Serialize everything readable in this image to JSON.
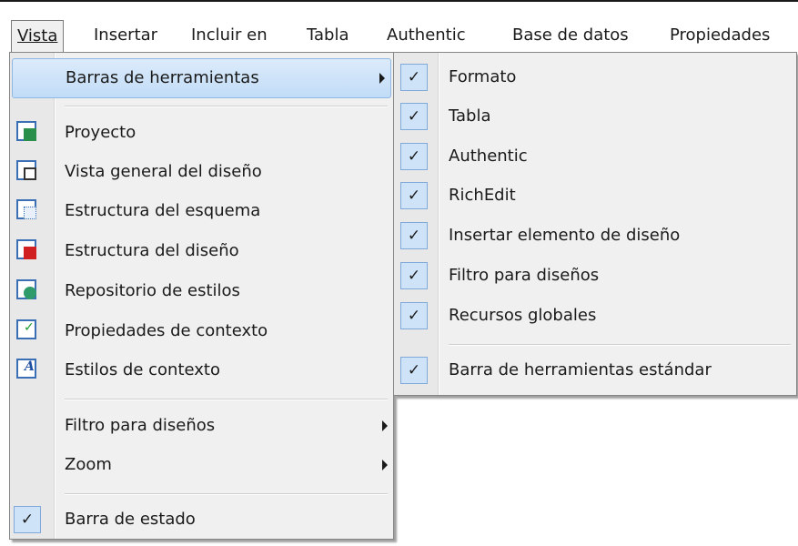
{
  "menubar": {
    "items": [
      {
        "label": "Vista",
        "active": true
      },
      {
        "label": "Insertar"
      },
      {
        "label": "Incluir en"
      },
      {
        "label": "Tabla"
      },
      {
        "label": "Authentic"
      },
      {
        "label": "Base de datos"
      },
      {
        "label": "Propiedades"
      }
    ]
  },
  "vista_menu": {
    "toolbars": "Barras de herramientas",
    "items": [
      {
        "label": "Proyecto",
        "icon": "project-window-icon"
      },
      {
        "label": "Vista general del diseño",
        "icon": "design-overview-icon"
      },
      {
        "label": "Estructura del esquema",
        "icon": "schema-tree-icon"
      },
      {
        "label": "Estructura del diseño",
        "icon": "design-tree-icon"
      },
      {
        "label": "Repositorio de estilos",
        "icon": "style-repository-icon"
      },
      {
        "label": "Propiedades de contexto",
        "icon": "context-properties-icon"
      },
      {
        "label": "Estilos de contexto",
        "icon": "context-styles-icon"
      }
    ],
    "design_filter": "Filtro para diseños",
    "zoom": "Zoom",
    "status_bar": "Barra de estado",
    "check_mark": "✓"
  },
  "toolbars_submenu": {
    "items": [
      {
        "label": "Formato",
        "checked": true
      },
      {
        "label": "Tabla",
        "checked": true
      },
      {
        "label": "Authentic",
        "checked": true
      },
      {
        "label": "RichEdit",
        "checked": true
      },
      {
        "label": "Insertar elemento de diseño",
        "checked": true
      },
      {
        "label": "Filtro para diseños",
        "checked": true
      },
      {
        "label": "Recursos globales",
        "checked": true
      }
    ],
    "standard": "Barra de herramientas estándar",
    "check_mark": "✓"
  },
  "colors": {
    "highlight": "#c1dcf7",
    "check_bg": "#cfe3f8",
    "icon_border": "#3a6fb5"
  }
}
